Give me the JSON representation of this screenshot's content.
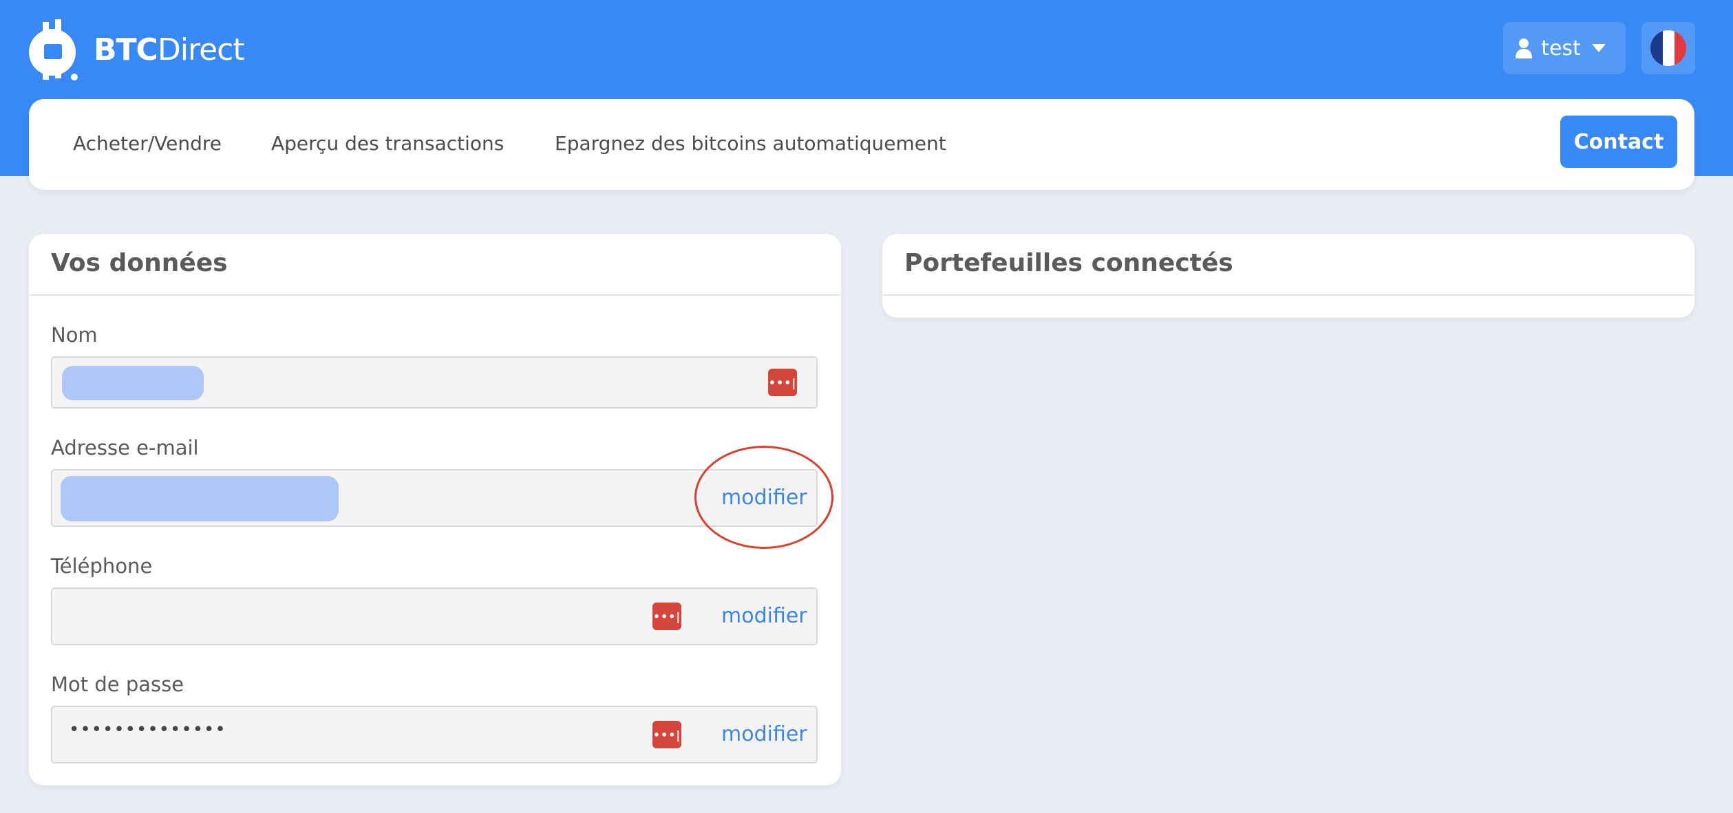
{
  "brand": {
    "name_bold": "BTC",
    "name_light": "Direct"
  },
  "header": {
    "user_label": "test"
  },
  "nav": {
    "items": [
      "Acheter/Vendre",
      "Aperçu des transactions",
      "Epargnez des bitcoins automatiquement"
    ],
    "contact_label": "Contact"
  },
  "profile": {
    "title": "Vos données",
    "fields": {
      "name_label": "Nom",
      "email_label": "Adresse e-mail",
      "phone_label": "Téléphone",
      "password_label": "Mot de passe",
      "password_value": "••••••••••••••"
    },
    "modify_label": "modifier"
  },
  "wallets": {
    "title": "Portefeuilles connectés"
  },
  "colors": {
    "brand_blue": "#3889f6",
    "annotation_red": "#d8412f",
    "password_manager_red": "#d4463c",
    "link_blue": "#3d86e6"
  },
  "icons": [
    "btcdirect-logo-icon",
    "user-icon",
    "caret-down-icon",
    "france-flag-icon",
    "password-manager-icon"
  ]
}
